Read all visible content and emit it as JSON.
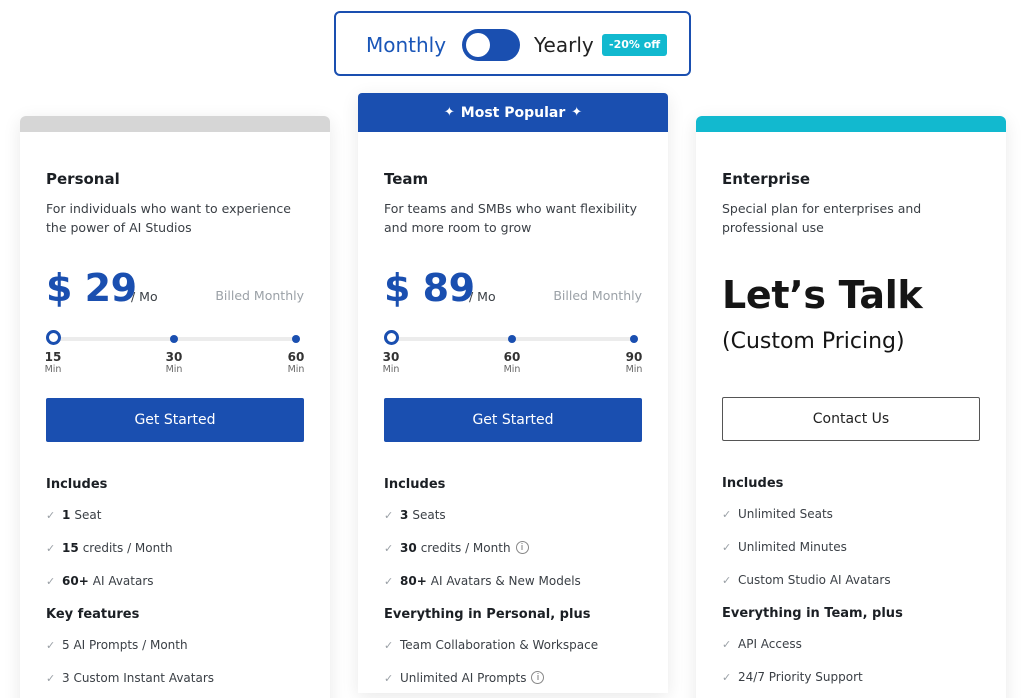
{
  "toggle": {
    "monthly": "Monthly",
    "yearly": "Yearly",
    "discount": "-20% off"
  },
  "popular": "Most Popular",
  "plans": [
    {
      "name": "Personal",
      "desc": "For individuals who want to experience the power of AI Studios",
      "price": "$ 29",
      "per": "/ Mo",
      "billed": "Billed Monthly",
      "ticks": [
        {
          "num": "15",
          "unit": "Min"
        },
        {
          "num": "30",
          "unit": "Min"
        },
        {
          "num": "60",
          "unit": "Min"
        }
      ],
      "cta": "Get Started",
      "includes_title": "Includes",
      "includes": [
        {
          "bold": "1",
          "text": "Seat"
        },
        {
          "bold": "15",
          "text": "credits / Month"
        },
        {
          "bold": "60+",
          "text": "AI Avatars"
        }
      ],
      "features_title": "Key features",
      "features": [
        "5 AI Prompts / Month",
        "3 Custom Instant Avatars"
      ]
    },
    {
      "name": "Team",
      "desc": "For teams and SMBs who want flexibility and more room to grow",
      "price": "$ 89",
      "per": "/ Mo",
      "billed": "Billed Monthly",
      "ticks": [
        {
          "num": "30",
          "unit": "Min"
        },
        {
          "num": "60",
          "unit": "Min"
        },
        {
          "num": "90",
          "unit": "Min"
        }
      ],
      "cta": "Get Started",
      "includes_title": "Includes",
      "includes": [
        {
          "bold": "3",
          "text": "Seats"
        },
        {
          "bold": "30",
          "text": "credits / Month"
        },
        {
          "bold": "80+",
          "text": "AI Avatars & New Models"
        }
      ],
      "features_title": "Everything in Personal, plus",
      "features": [
        "Team Collaboration & Workspace",
        "Unlimited AI Prompts"
      ]
    },
    {
      "name": "Enterprise",
      "desc": "Special plan for enterprises and professional use",
      "price_text": "Let’s Talk",
      "price_sub": "(Custom Pricing)",
      "cta": "Contact Us",
      "includes_title": "Includes",
      "includes": [
        "Unlimited Seats",
        "Unlimited Minutes",
        "Custom Studio AI Avatars"
      ],
      "features_title": "Everything in Team, plus",
      "features": [
        "API Access",
        "24/7 Priority Support"
      ]
    }
  ],
  "colors": {
    "primary": "#1a4fb0",
    "accent": "#12b9cf",
    "muted_bar": "#d6d6d6"
  }
}
